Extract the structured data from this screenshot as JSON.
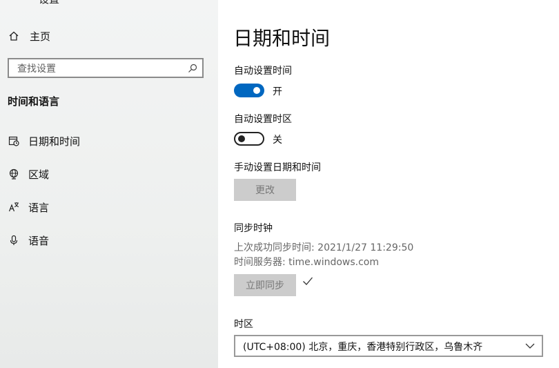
{
  "sidebar": {
    "top_title": "设置",
    "home_label": "主页",
    "search_placeholder": "查找设置",
    "section_header": "时间和语言",
    "items": [
      {
        "label": "日期和时间",
        "icon": "calendar-clock-icon"
      },
      {
        "label": "区域",
        "icon": "globe-icon"
      },
      {
        "label": "语言",
        "icon": "language-icon"
      },
      {
        "label": "语音",
        "icon": "microphone-icon"
      }
    ]
  },
  "main": {
    "title": "日期和时间",
    "auto_time": {
      "label": "自动设置时间",
      "state": "开",
      "on": true
    },
    "auto_timezone": {
      "label": "自动设置时区",
      "state": "关",
      "on": false
    },
    "manual": {
      "label": "手动设置日期和时间",
      "button": "更改"
    },
    "sync": {
      "header": "同步时钟",
      "last_sync": "上次成功同步时间: 2021/1/27 11:29:50",
      "server": "时间服务器: time.windows.com",
      "button": "立即同步"
    },
    "timezone": {
      "label": "时区",
      "value": "(UTC+08:00) 北京，重庆，香港特别行政区，乌鲁木齐"
    }
  },
  "colors": {
    "accent": "#0067c0",
    "button_disabled": "#cccccc"
  }
}
